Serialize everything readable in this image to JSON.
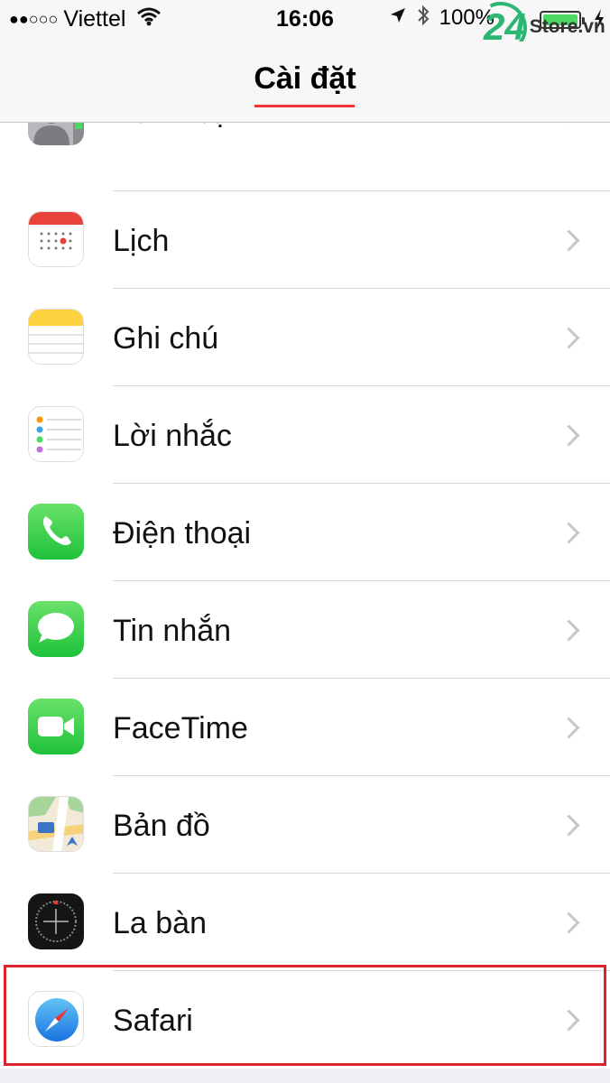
{
  "status_bar": {
    "signal_dots": "●●○○○",
    "carrier": "Viettel",
    "time": "16:06",
    "battery_percent": "100%",
    "icons": [
      "wifi-icon",
      "location-arrow-icon",
      "bluetooth-icon",
      "battery-icon",
      "charging-bolt-icon"
    ]
  },
  "watermark": {
    "number": "24",
    "text": "Store.vn"
  },
  "nav": {
    "title": "Cài đặt"
  },
  "rows": [
    {
      "label": "Danh bạ",
      "icon": "contacts-icon"
    },
    {
      "label": "Lịch",
      "icon": "calendar-icon"
    },
    {
      "label": "Ghi chú",
      "icon": "notes-icon"
    },
    {
      "label": "Lời nhắc",
      "icon": "reminders-icon"
    },
    {
      "label": "Điện thoại",
      "icon": "phone-icon"
    },
    {
      "label": "Tin nhắn",
      "icon": "messages-icon"
    },
    {
      "label": "FaceTime",
      "icon": "facetime-icon"
    },
    {
      "label": "Bản đồ",
      "icon": "maps-icon"
    },
    {
      "label": "La bàn",
      "icon": "compass-icon"
    },
    {
      "label": "Safari",
      "icon": "safari-icon"
    }
  ],
  "highlighted_row": "Safari",
  "colors": {
    "highlight": "#d9232e",
    "accent_underline": "#e33333"
  }
}
